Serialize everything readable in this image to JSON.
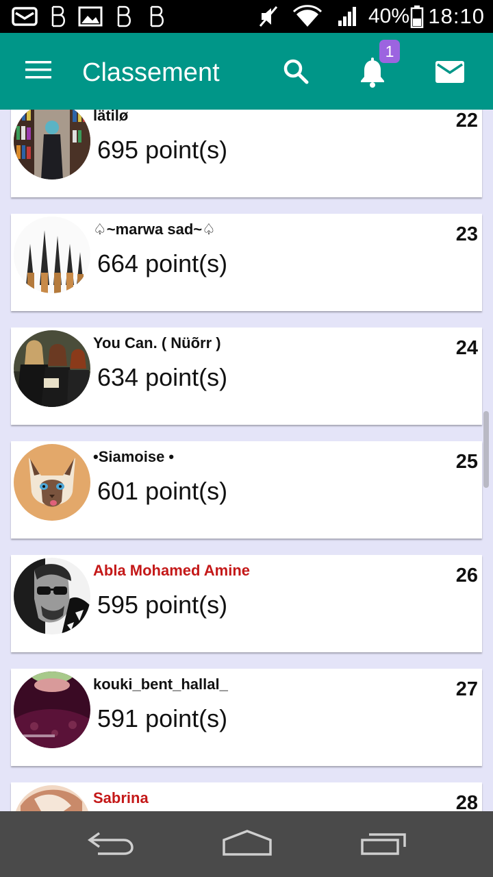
{
  "status_bar": {
    "battery_percent": "40%",
    "time": "18:10",
    "icons": [
      "message-icon",
      "b-icon",
      "gallery-icon",
      "b-icon",
      "b-icon",
      "mute-icon",
      "wifi-icon",
      "signal-icon",
      "battery-icon"
    ]
  },
  "app_bar": {
    "title": "Classement",
    "notification_count": "1",
    "background_color": "#009688",
    "badge_color": "#9c64e0"
  },
  "leaderboard": [
    {
      "name": "lätilø",
      "points": "695 point(s)",
      "rank": "22",
      "name_color": "#111111"
    },
    {
      "name": "♤~marwa sad~♤",
      "points": "664 point(s)",
      "rank": "23",
      "name_color": "#111111"
    },
    {
      "name": "You Can. ( Nüõrr )",
      "points": "634 point(s)",
      "rank": "24",
      "name_color": "#111111"
    },
    {
      "name": "•Siamoise •",
      "points": "601 point(s)",
      "rank": "25",
      "name_color": "#111111"
    },
    {
      "name": "Abla Mohamed Amine",
      "points": "595 point(s)",
      "rank": "26",
      "name_color": "#c41818"
    },
    {
      "name": "kouki_bent_hallal_",
      "points": "591 point(s)",
      "rank": "27",
      "name_color": "#111111"
    },
    {
      "name": "Sabrina",
      "points": "",
      "rank": "28",
      "name_color": "#c41818"
    }
  ],
  "colors": {
    "list_background": "#e4e4f8",
    "nav_bar": "#4a4a4a"
  }
}
